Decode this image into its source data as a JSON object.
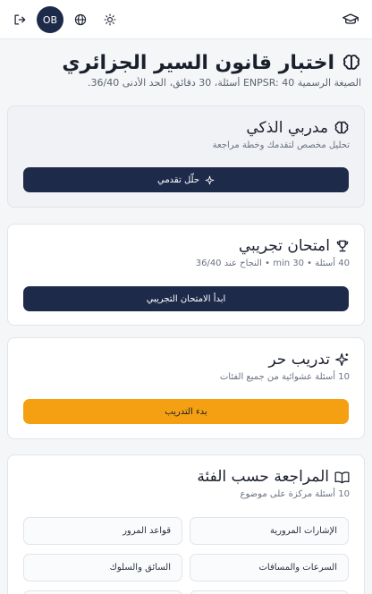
{
  "topbar": {
    "avatar_initials": "OB",
    "icons": [
      "graduation-cap-icon",
      "logout-icon",
      "globe-icon",
      "sun-icon"
    ]
  },
  "header": {
    "title": "اختبار قانون السير الجزائري",
    "subtitle": "الصيغة الرسمية ENPSR: 40 أسئلة، 30 دقائق، الحد الأدنى 36/40."
  },
  "coach_card": {
    "title": "مدربي الذكي",
    "description": "تحليل مخصص لتقدمك وخطة مراجعة",
    "button_label": "حلّل تقدمي"
  },
  "exam_card": {
    "title": "امتحان تجريبي",
    "description": "40 أسئلة • 30 min • النجاح عند 36/40",
    "button_label": "ابدأ الامتحان التجريبي"
  },
  "practice_card": {
    "title": "تدريب حر",
    "description": "10 أسئلة عشوائية من جميع الفئات",
    "button_label": "بدء التدريب"
  },
  "categories_card": {
    "title": "المراجعة حسب الفئة",
    "description": "10 أسئلة مركزة على موضوع",
    "items": [
      "الإشارات المرورية",
      "قواعد المرور",
      "السرعات والمسافات",
      "السائق والسلوك"
    ]
  },
  "colors": {
    "primary_dark": "#1e2a4a",
    "accent_orange": "#f4a012",
    "background": "#f5f6f8"
  }
}
